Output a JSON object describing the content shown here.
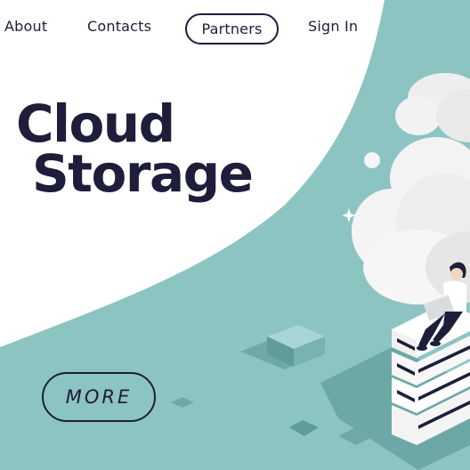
{
  "nav": {
    "about": "About",
    "contacts": "Contacts",
    "partners": "Partners",
    "sign_in": "Sign In"
  },
  "hero": {
    "title_line1": "Cloud",
    "title_line2": "Storage",
    "more_button": "MORE"
  },
  "colors": {
    "teal": "#8cc4c2",
    "navy": "#1e1d3a",
    "white": "#ffffff"
  }
}
